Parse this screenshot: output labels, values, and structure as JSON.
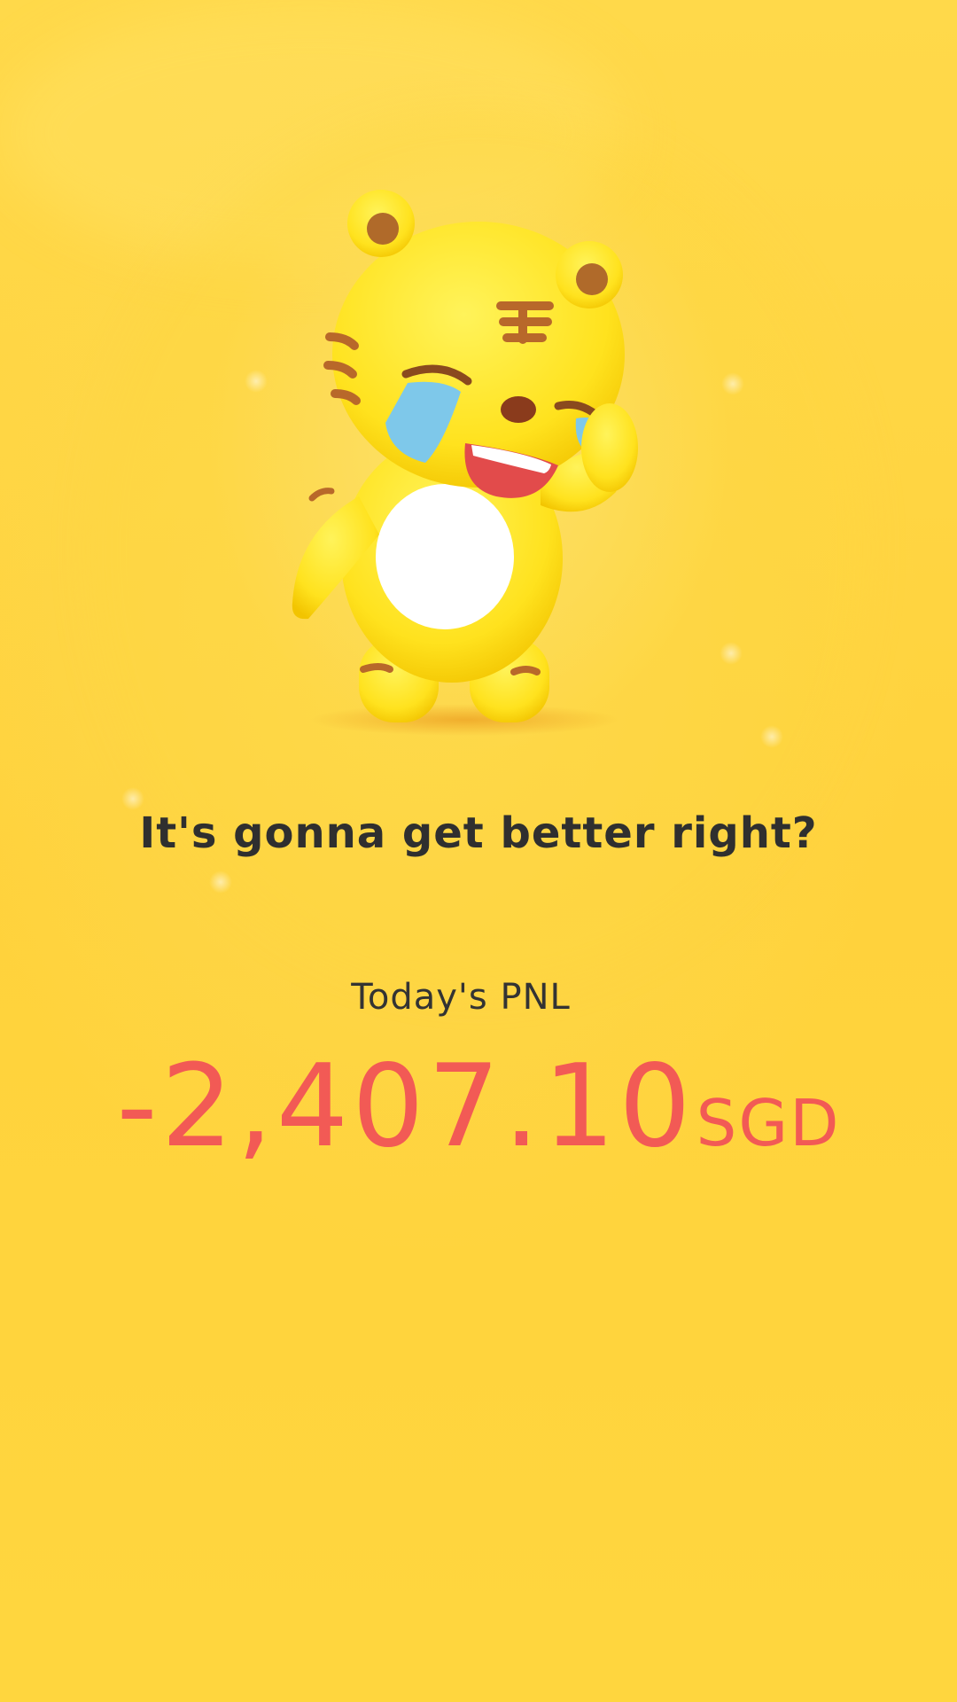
{
  "mascot": {
    "icon": "crying-tiger-mascot-icon"
  },
  "message": {
    "headline": "It's gonna get better right?"
  },
  "pnl": {
    "label": "Today's PNL",
    "amount": "-2,407.10",
    "currency": "SGD"
  },
  "colors": {
    "background": "#ffd63e",
    "text_dark": "#2f2f2f",
    "loss_red": "#f25a55"
  }
}
